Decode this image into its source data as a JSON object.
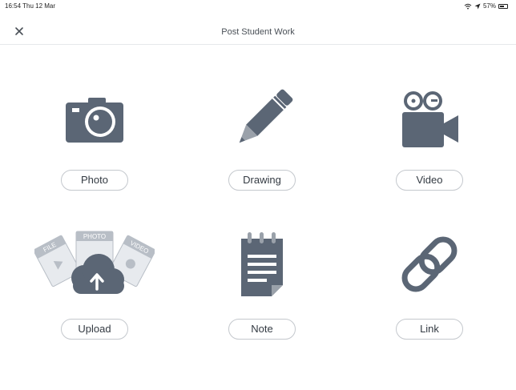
{
  "status": {
    "time": "16:54",
    "date": "Thu 12 Mar",
    "battery": "57%"
  },
  "header": {
    "title": "Post Student Work",
    "close_icon": "close-icon"
  },
  "options": [
    {
      "label": "Photo",
      "icon": "camera-icon"
    },
    {
      "label": "Drawing",
      "icon": "pencil-icon"
    },
    {
      "label": "Video",
      "icon": "video-camera-icon"
    },
    {
      "label": "Upload",
      "icon": "cloud-upload-icon",
      "icon_labels": [
        "FILE",
        "PHOTO",
        "VIDEO"
      ]
    },
    {
      "label": "Note",
      "icon": "notepad-icon"
    },
    {
      "label": "Link",
      "icon": "chain-link-icon"
    }
  ],
  "colors": {
    "icon": "#5b6675",
    "border": "#c4c8cd",
    "text": "#333a42"
  }
}
